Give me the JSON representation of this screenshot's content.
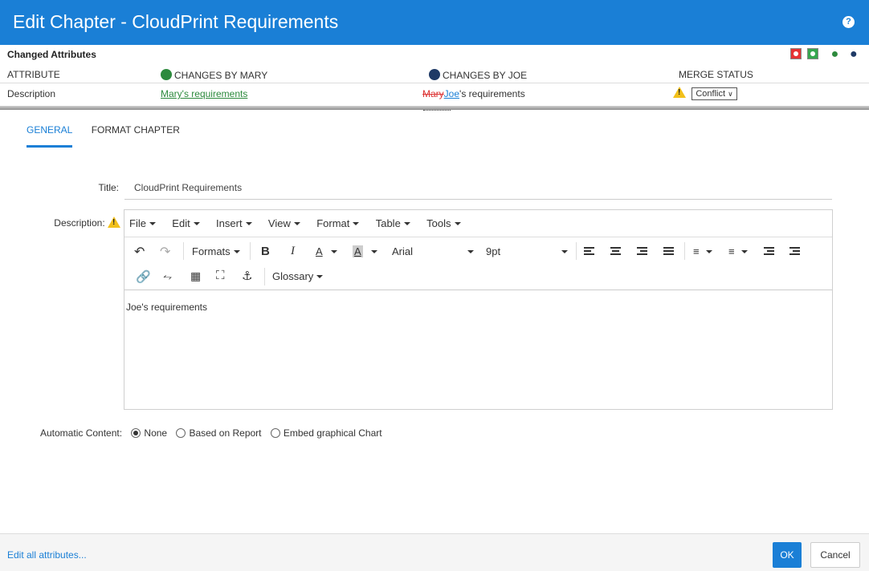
{
  "window": {
    "title": "Edit Chapter - CloudPrint Requirements",
    "help_icon": "?"
  },
  "changes": {
    "heading": "Changed Attributes",
    "columns": {
      "attribute": "ATTRIBUTE",
      "mary": "CHANGES BY MARY",
      "joe": "CHANGES BY JOE",
      "merge": "MERGE STATUS"
    },
    "row": {
      "attribute": "Description",
      "mary_value": "Mary's requirements",
      "joe_struck": "Mary",
      "joe_inserted": "Joe",
      "joe_rest": "'s requirements",
      "merge_value": "Conflict"
    },
    "colors": {
      "mary": "#2d8a3d",
      "joe": "#1f3a66",
      "accent": "#1a7fd6"
    }
  },
  "tabs": [
    {
      "label": "GENERAL",
      "active": true
    },
    {
      "label": "FORMAT CHAPTER",
      "active": false
    }
  ],
  "form": {
    "title_label": "Title:",
    "title_value": "CloudPrint Requirements",
    "description_label": "Description:",
    "menus": [
      "File",
      "Edit",
      "Insert",
      "View",
      "Format",
      "Table",
      "Tools"
    ],
    "toolbar": {
      "formats": "Formats",
      "font": "Arial",
      "size": "9pt",
      "glossary": "Glossary",
      "bold": "B",
      "italic": "I",
      "font_color": "A",
      "bg_color": "A"
    },
    "content": "Joe's requirements",
    "automatic_label": "Automatic Content:",
    "automatic_options": [
      {
        "label": "None",
        "checked": true
      },
      {
        "label": "Based on Report",
        "checked": false
      },
      {
        "label": "Embed graphical Chart",
        "checked": false
      }
    ]
  },
  "footer": {
    "edit_all": "Edit all attributes...",
    "ok": "OK",
    "cancel": "Cancel"
  }
}
